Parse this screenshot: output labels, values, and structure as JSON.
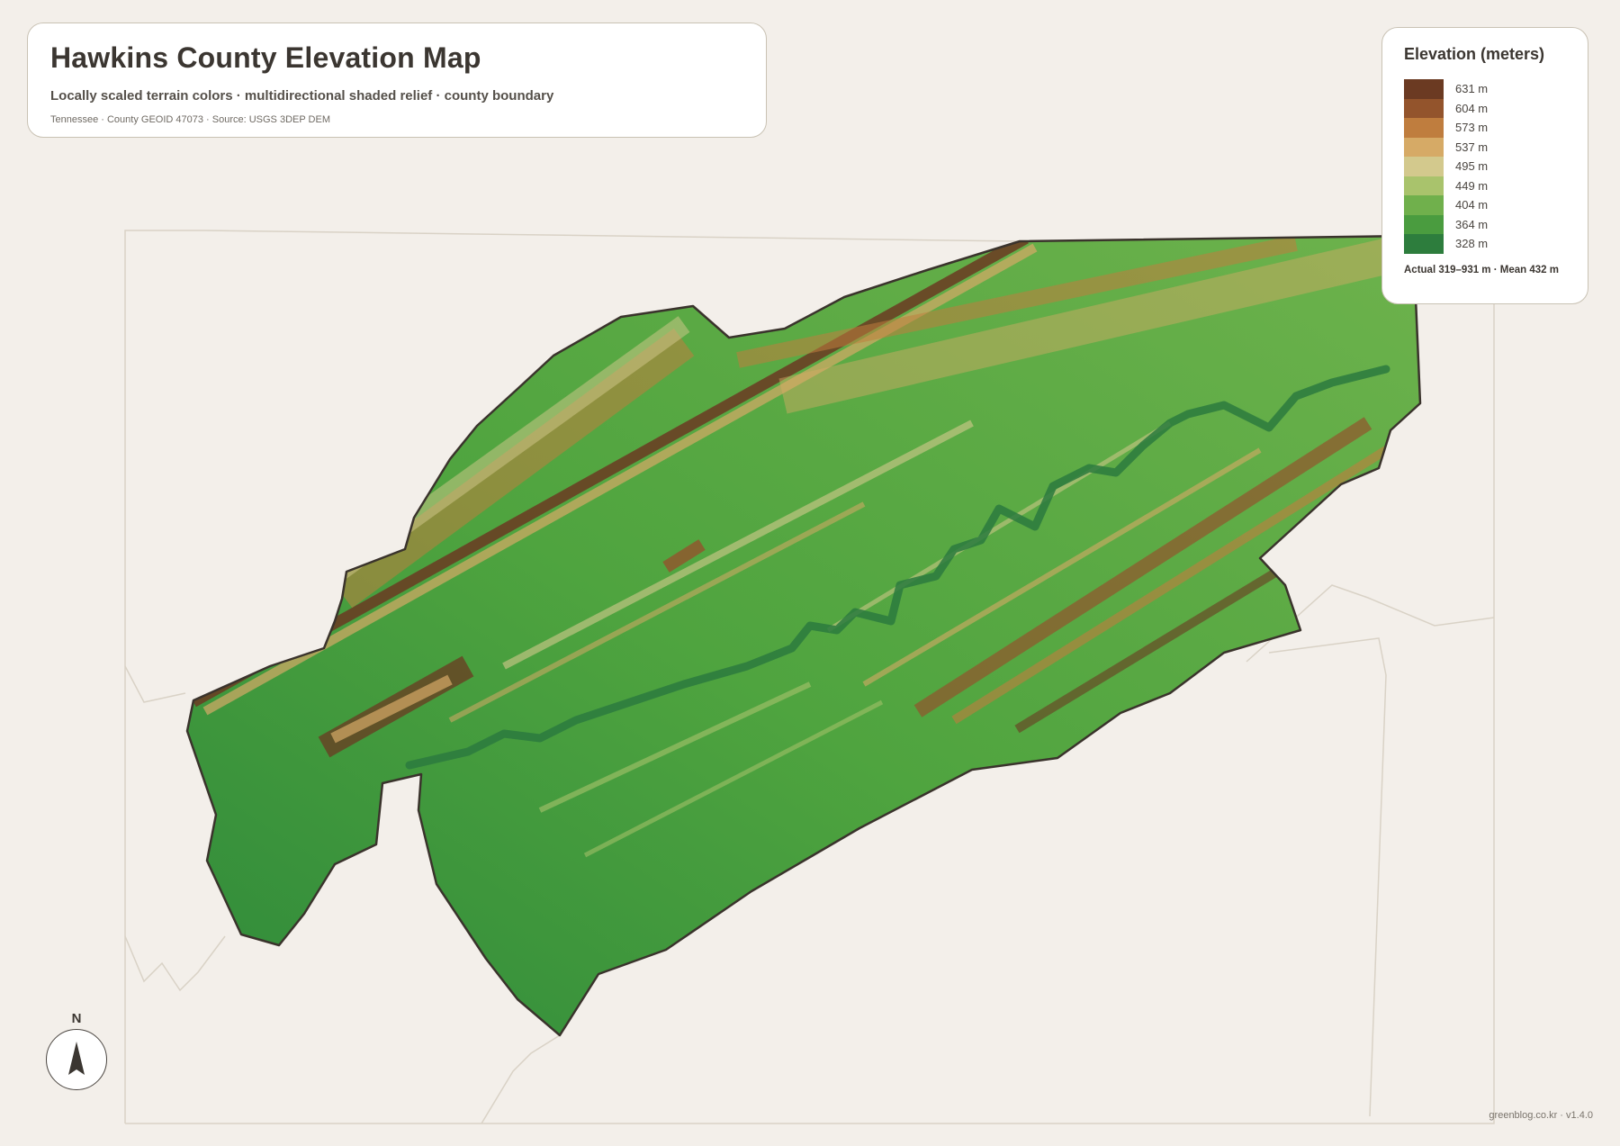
{
  "header": {
    "title": "Hawkins County Elevation Map",
    "subtitle": "Locally scaled terrain colors · multidirectional shaded relief · county boundary",
    "meta": "Tennessee · County GEOID 47073 · Source: USGS 3DEP DEM"
  },
  "legend": {
    "title": "Elevation (meters)",
    "items": [
      {
        "label": "631 m",
        "color": "#6b3a22"
      },
      {
        "label": "604 m",
        "color": "#93542c"
      },
      {
        "label": "573 m",
        "color": "#bf7d3e"
      },
      {
        "label": "537 m",
        "color": "#d6aa66"
      },
      {
        "label": "495 m",
        "color": "#d3c98d"
      },
      {
        "label": "449 m",
        "color": "#a9c36c"
      },
      {
        "label": "404 m",
        "color": "#70b04c"
      },
      {
        "label": "364 m",
        "color": "#4a9c3f"
      },
      {
        "label": "328 m",
        "color": "#2d7d3d"
      }
    ],
    "stats": "Actual 319–931 m · Mean 432 m"
  },
  "compass": {
    "label": "N",
    "icon": "north-arrow-icon"
  },
  "credit": "greenblog.co.kr · v1.4.0",
  "colors": {
    "background": "#f3efea",
    "boundary_line": "#d9d2c6",
    "county_outline": "#3a332c",
    "lowland": "#2f8a3a",
    "river": "#2c7a3e",
    "ridge_high": "#6b3a22",
    "ridge_mid": "#d6aa66"
  }
}
